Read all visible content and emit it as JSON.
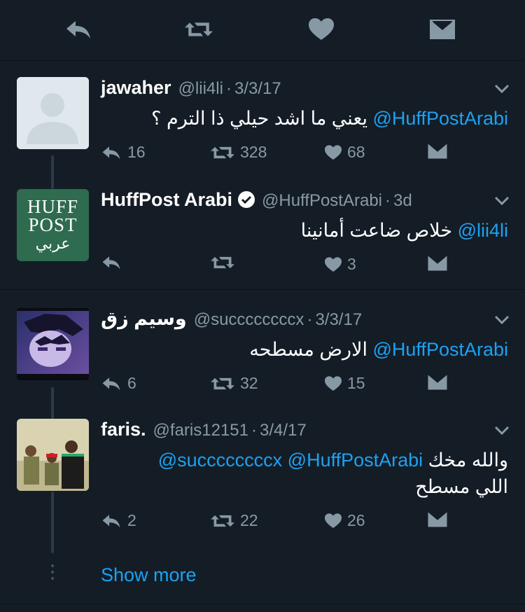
{
  "topbar": {
    "icons": [
      "reply-icon",
      "retweet-icon",
      "like-icon",
      "dm-icon"
    ]
  },
  "tweets": [
    {
      "name": "jawaher",
      "handle": "@lii4li",
      "date": "3/3/17",
      "mention": "@HuffPostArabi",
      "text": "يعني ما اشد حيلي ذا الترم ؟",
      "replies": "16",
      "retweets": "328",
      "likes": "68"
    },
    {
      "name": "HuffPost Arabi",
      "handle": "@HuffPostArabi",
      "date": "3d",
      "mention": "@lii4li",
      "text": "خلاص ضاعت أمانينا",
      "replies": "",
      "retweets": "",
      "likes": "3",
      "logo_line1": "HUFF",
      "logo_line2": "POST",
      "logo_line3": "عربي"
    },
    {
      "name": "وسيم زق",
      "handle": "@succccccccx",
      "date": "3/3/17",
      "mention": "@HuffPostArabi",
      "text": "الارض مسطحه",
      "replies": "6",
      "retweets": "32",
      "likes": "15"
    },
    {
      "name": "faris.",
      "handle": "@faris12151",
      "date": "3/4/17",
      "mention1": "@HuffPostArabi",
      "mention2": "@succccccccx",
      "text1": "والله مخك",
      "text2": "اللي مسطح",
      "replies": "2",
      "retweets": "22",
      "likes": "26"
    }
  ],
  "show_more": "Show more",
  "colors": {
    "background": "#141d26",
    "link": "#1da1f2",
    "muted": "#8899a6",
    "huffpost_green": "#2e6b4f"
  }
}
